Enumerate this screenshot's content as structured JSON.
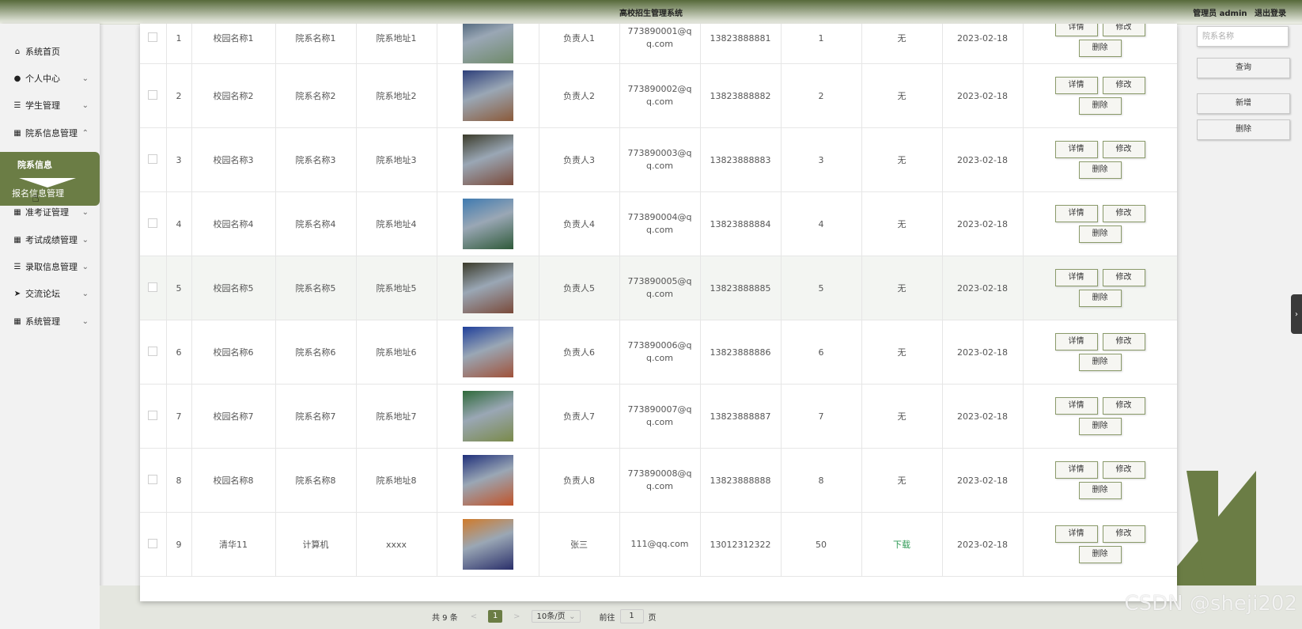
{
  "header": {
    "title": "高校招生管理系统",
    "admin": "管理员 admin",
    "logout": "退出登录"
  },
  "sidebar": {
    "items": [
      {
        "label": "系统首页",
        "icon": "home-icon",
        "glyph": "⌂",
        "chev": ""
      },
      {
        "label": "个人中心",
        "icon": "user-icon",
        "glyph": "●",
        "chev": "⌄"
      },
      {
        "label": "学生管理",
        "icon": "sliders-icon",
        "glyph": "☰",
        "chev": "⌄"
      },
      {
        "label": "院系信息管理",
        "icon": "grid-icon",
        "glyph": "▦",
        "chev": "⌃"
      },
      {
        "label": "准考证管理",
        "icon": "grid-icon",
        "glyph": "▦",
        "chev": "⌄"
      },
      {
        "label": "考试成绩管理",
        "icon": "grid-icon",
        "glyph": "▦",
        "chev": "⌄"
      },
      {
        "label": "录取信息管理",
        "icon": "list-icon",
        "glyph": "☰",
        "chev": "⌄"
      },
      {
        "label": "交流论坛",
        "icon": "send-icon",
        "glyph": "➤",
        "chev": "⌄"
      },
      {
        "label": "系统管理",
        "icon": "apps-icon",
        "glyph": "▦",
        "chev": "⌄"
      }
    ],
    "submenu_active": "院系信息",
    "submenu_next": "报名信息管理"
  },
  "actions": {
    "detail": "详情",
    "edit": "修改",
    "delete": "删除"
  },
  "table": {
    "rows": [
      {
        "no": "1",
        "campus": "校园名称1",
        "dept": "院系名称1",
        "addr": "院系地址1",
        "img_colors": [
          "#2f4a63",
          "#6f8a6a"
        ],
        "leader": "负责人1",
        "email": "773890001@qq.com",
        "phone": "13823888881",
        "num": "1",
        "file": "无",
        "date": "2023-02-18"
      },
      {
        "no": "2",
        "campus": "校园名称2",
        "dept": "院系名称2",
        "addr": "院系地址2",
        "img_colors": [
          "#2d3f7a",
          "#8b5a3a"
        ],
        "leader": "负责人2",
        "email": "773890002@qq.com",
        "phone": "13823888882",
        "num": "2",
        "file": "无",
        "date": "2023-02-18"
      },
      {
        "no": "3",
        "campus": "校园名称3",
        "dept": "院系名称3",
        "addr": "院系地址3",
        "img_colors": [
          "#3b3b2a",
          "#7a4a3a"
        ],
        "leader": "负责人3",
        "email": "773890003@qq.com",
        "phone": "13823888883",
        "num": "3",
        "file": "无",
        "date": "2023-02-18"
      },
      {
        "no": "4",
        "campus": "校园名称4",
        "dept": "院系名称4",
        "addr": "院系地址4",
        "img_colors": [
          "#3f7ab0",
          "#2f5a3a"
        ],
        "leader": "负责人4",
        "email": "773890004@qq.com",
        "phone": "13823888884",
        "num": "4",
        "file": "无",
        "date": "2023-02-18"
      },
      {
        "no": "5",
        "campus": "校园名称5",
        "dept": "院系名称5",
        "addr": "院系地址5",
        "img_colors": [
          "#3b3b2a",
          "#7a4a3a"
        ],
        "leader": "负责人5",
        "email": "773890005@qq.com",
        "phone": "13823888885",
        "num": "5",
        "file": "无",
        "date": "2023-02-18"
      },
      {
        "no": "6",
        "campus": "校园名称6",
        "dept": "院系名称6",
        "addr": "院系地址6",
        "img_colors": [
          "#1f3f9a",
          "#a0523a"
        ],
        "leader": "负责人6",
        "email": "773890006@qq.com",
        "phone": "13823888886",
        "num": "6",
        "file": "无",
        "date": "2023-02-18"
      },
      {
        "no": "7",
        "campus": "校园名称7",
        "dept": "院系名称7",
        "addr": "院系地址7",
        "img_colors": [
          "#2f6a3a",
          "#7a8a4a"
        ],
        "leader": "负责人7",
        "email": "773890007@qq.com",
        "phone": "13823888887",
        "num": "7",
        "file": "无",
        "date": "2023-02-18"
      },
      {
        "no": "8",
        "campus": "校园名称8",
        "dept": "院系名称8",
        "addr": "院系地址8",
        "img_colors": [
          "#1f2f7a",
          "#c0542a"
        ],
        "leader": "负责人8",
        "email": "773890008@qq.com",
        "phone": "13823888888",
        "num": "8",
        "file": "无",
        "date": "2023-02-18"
      },
      {
        "no": "9",
        "campus": "清华11",
        "dept": "计算机",
        "addr": "xxxx",
        "img_colors": [
          "#d07a2a",
          "#2a2f6a"
        ],
        "leader": "张三",
        "email": "111@qq.com",
        "phone": "13012312322",
        "num": "50",
        "file": "下载",
        "date": "2023-02-18"
      }
    ]
  },
  "search": {
    "placeholder": "院系名称",
    "query": "查询",
    "add": "新增",
    "delete": "删除"
  },
  "pagination": {
    "total": "共 9 条",
    "prev": "<",
    "page": "1",
    "next": ">",
    "page_size": "10条/页",
    "goto": "前往",
    "goto_value": "1",
    "goto_suffix": "页"
  },
  "watermark": "CSDN @sheji202",
  "colors": {
    "accent": "#6b7d45",
    "download": "#2e9a55"
  }
}
